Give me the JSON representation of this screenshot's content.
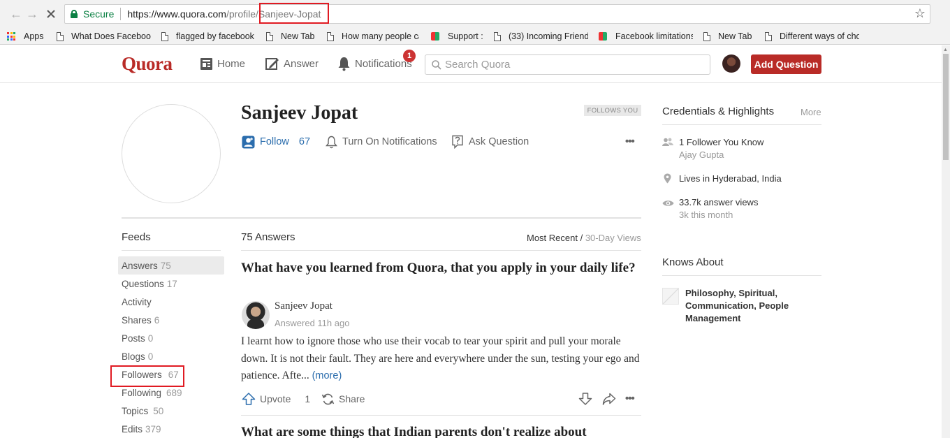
{
  "browser": {
    "secure_label": "Secure",
    "url_base": "https://www.quora.com",
    "url_path": "/profile/",
    "url_slug": "Sanjeev-Jopat",
    "bookmarks": [
      {
        "label": "Apps",
        "icon": "apps-grid-icon"
      },
      {
        "label": "What Does Facebook",
        "icon": "page-icon"
      },
      {
        "label": "flagged by facebook",
        "icon": "page-icon"
      },
      {
        "label": "New Tab",
        "icon": "page-icon"
      },
      {
        "label": "How many people ca",
        "icon": "page-icon"
      },
      {
        "label": "Support :",
        "icon": "site-icon"
      },
      {
        "label": "(33) Incoming Friend",
        "icon": "page-icon"
      },
      {
        "label": "Facebook limitations",
        "icon": "site-icon"
      },
      {
        "label": "New Tab",
        "icon": "page-icon"
      },
      {
        "label": "Different ways of cho",
        "icon": "page-icon"
      }
    ]
  },
  "header": {
    "logo": "Quora",
    "nav": {
      "home": "Home",
      "answer": "Answer",
      "notifications": "Notifications"
    },
    "notifications_badge": "1",
    "search_placeholder": "Search Quora",
    "add_question": "Add Question",
    "brand_color": "#b92b27"
  },
  "profile": {
    "name": "Sanjeev Jopat",
    "follows_you": "FOLLOWS YOU",
    "follow_label": "Follow",
    "follow_count": "67",
    "notifications_label": "Turn On Notifications",
    "ask_label": "Ask Question",
    "more_label": "•••"
  },
  "feeds": {
    "title": "Feeds",
    "items": [
      {
        "label": "Answers",
        "count": "75",
        "active": true
      },
      {
        "label": "Questions",
        "count": "17"
      },
      {
        "label": "Activity",
        "count": ""
      },
      {
        "label": "Shares",
        "count": "6"
      },
      {
        "label": "Posts",
        "count": "0"
      },
      {
        "label": "Blogs",
        "count": "0"
      },
      {
        "label": "Followers",
        "count": "67"
      },
      {
        "label": "Following",
        "count": "689"
      },
      {
        "label": "Topics",
        "count": "50"
      },
      {
        "label": "Edits",
        "count": "379"
      }
    ]
  },
  "main": {
    "answers_count": "75 Answers",
    "sort_active": "Most Recent",
    "sort_sep": " / ",
    "sort_alt": "30-Day Views",
    "answer": {
      "question": "What have you learned from Quora, that you apply in your daily life?",
      "author": "Sanjeev Jopat",
      "answered": "Answered 11h ago",
      "text": "I learnt how to ignore those who use their vocab to tear your spirit and pull your morale down. It is not their fault. They are here and everywhere under the sun, testing your ego and patience. Afte...",
      "more": "(more)",
      "upvote_label": "Upvote",
      "upvote_count": "1",
      "share_label": "Share",
      "more_label": "•••"
    },
    "next_question": "What are some things that Indian parents don't realize about"
  },
  "right": {
    "credentials_title": "Credentials & Highlights",
    "more": "More",
    "followers_know": "1 Follower You Know",
    "follower_name": "Ajay Gupta",
    "location": "Lives in Hyderabad, India",
    "views": "33.7k answer views",
    "views_month": "3k this month",
    "knows_title": "Knows About",
    "topics": "Philosophy, Spiritual, Communication, People Management"
  }
}
